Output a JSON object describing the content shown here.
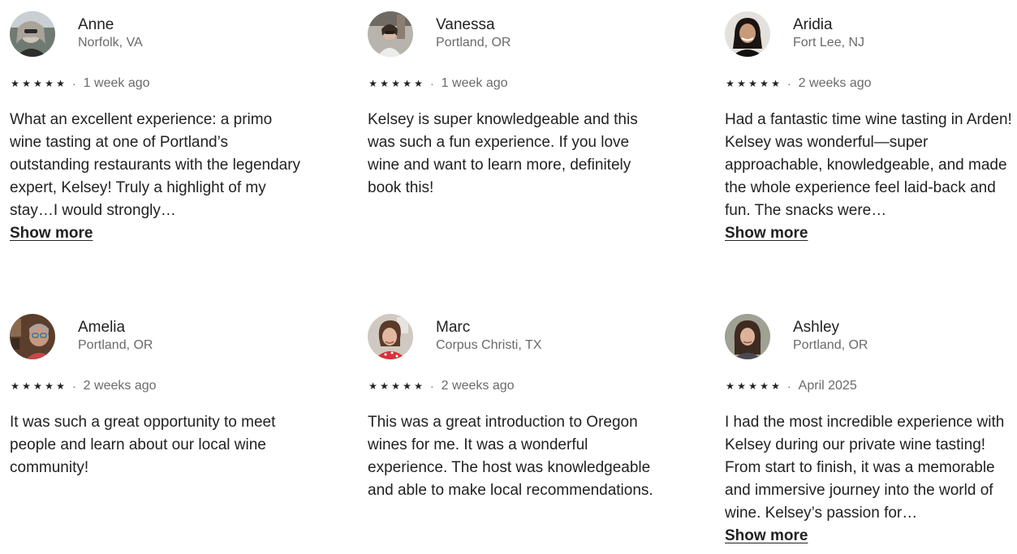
{
  "reviews": [
    {
      "name": "Anne",
      "location": "Norfolk, VA",
      "stars": "★★★★★",
      "separator": "·",
      "date": "1 week ago",
      "text": "What an excellent experience: a primo wine tasting at one of Portland’s outstanding restaurants with the legendary expert, Kelsey! Truly a highlight of my stay…I would strongly…",
      "show_more": "Show more",
      "avatar_color": "#5a5a55"
    },
    {
      "name": "Vanessa",
      "location": "Portland, OR",
      "stars": "★★★★★",
      "separator": "·",
      "date": "1 week ago",
      "text": "Kelsey is super knowledgeable and this was such a fun experience. If you love wine and want to learn more, definitely book this!",
      "show_more": "",
      "avatar_color": "#8c8a86"
    },
    {
      "name": "Aridia",
      "location": "Fort Lee, NJ",
      "stars": "★★★★★",
      "separator": "·",
      "date": "2 weeks ago",
      "text": "Had a fantastic time wine tasting in Arden! Kelsey was wonderful—super approachable, knowledgeable, and made the whole experience feel laid-back and fun. The snacks were…",
      "show_more": "Show more",
      "avatar_color": "#d9d6d2"
    },
    {
      "name": "Amelia",
      "location": "Portland, OR",
      "stars": "★★★★★",
      "separator": "·",
      "date": "2 weeks ago",
      "text": "It was such a great opportunity to meet people and learn about our local wine community!",
      "show_more": "",
      "avatar_color": "#6b4a35"
    },
    {
      "name": "Marc",
      "location": "Corpus Christi, TX",
      "stars": "★★★★★",
      "separator": "·",
      "date": "2 weeks ago",
      "text": "This was a great introduction to Oregon wines for me. It was a wonderful experience. The host was knowledgeable and able to make local recommendations.",
      "show_more": "",
      "avatar_color": "#b9b2aa"
    },
    {
      "name": "Ashley",
      "location": "Portland, OR",
      "stars": "★★★★★",
      "separator": "·",
      "date": "April 2025",
      "text": "I had the most incredible experience with Kelsey during our private wine tasting! From start to finish, it was a memorable and immersive journey into the world of wine. Kelsey’s passion for…",
      "show_more": "Show more",
      "avatar_color": "#9a9189"
    }
  ]
}
